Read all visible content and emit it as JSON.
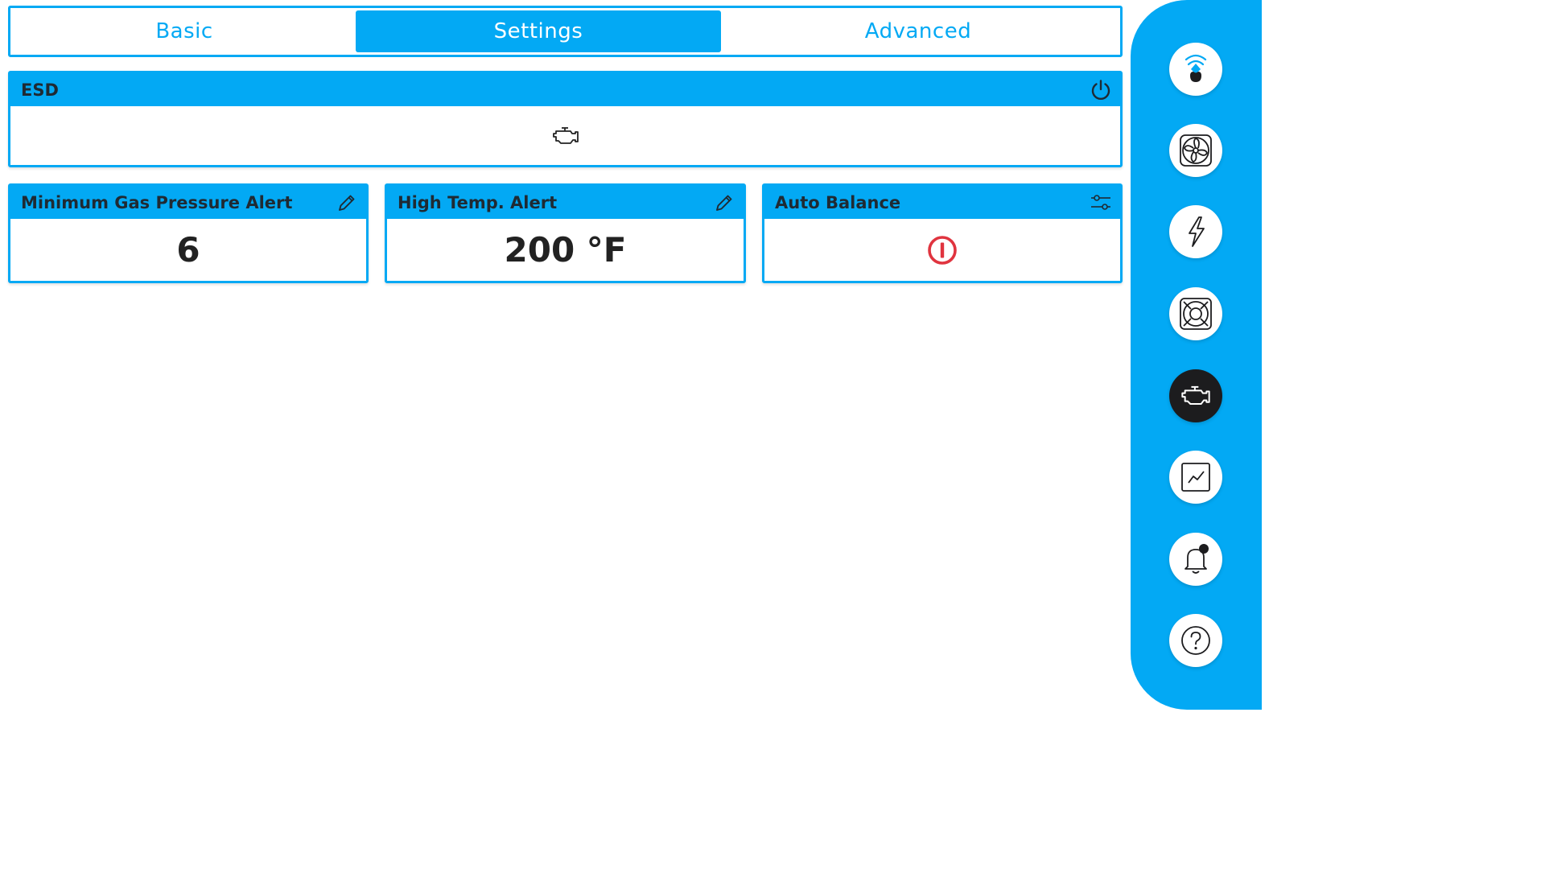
{
  "tabs": [
    {
      "label": "Basic",
      "active": false
    },
    {
      "label": "Settings",
      "active": true
    },
    {
      "label": "Advanced",
      "active": false
    }
  ],
  "esd": {
    "title": "ESD",
    "header_icon": "power-icon",
    "body_icon": "engine-icon"
  },
  "cards": {
    "min_gas": {
      "title": "Minimum Gas Pressure Alert",
      "value": "6",
      "icon": "pencil-icon"
    },
    "high_temp": {
      "title": "High Temp. Alert",
      "value": "200 °F",
      "icon": "pencil-icon"
    },
    "auto_balance": {
      "title": "Auto Balance",
      "icon": "sliders-icon",
      "state_icon": "power-off-icon"
    }
  },
  "sidebar": {
    "items": [
      {
        "icon": "wifi-drop-icon",
        "active": false
      },
      {
        "icon": "fan-icon",
        "active": false
      },
      {
        "icon": "lightning-icon",
        "active": false
      },
      {
        "icon": "radiator-icon",
        "active": false
      },
      {
        "icon": "engine-icon",
        "active": true
      },
      {
        "icon": "chart-icon",
        "active": false
      },
      {
        "icon": "bell-icon",
        "active": false
      },
      {
        "icon": "help-icon",
        "active": false
      }
    ]
  },
  "colors": {
    "accent": "#03a9f4",
    "dark": "#1c1c1e",
    "alert_red": "#e0343f"
  }
}
